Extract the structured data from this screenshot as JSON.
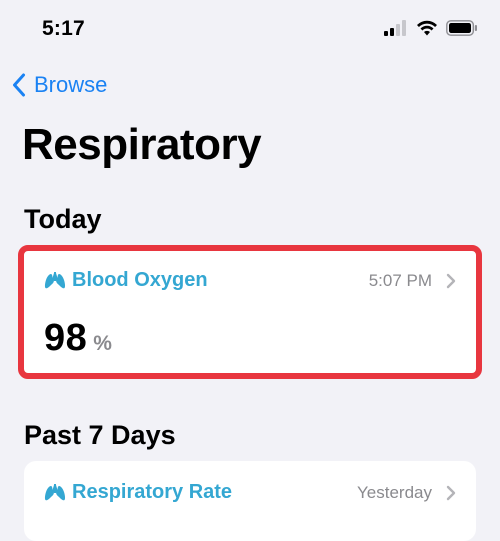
{
  "status_bar": {
    "time": "5:17",
    "icons": [
      "cellular-signal-icon",
      "wifi-icon",
      "battery-icon"
    ]
  },
  "nav": {
    "back_label": "Browse",
    "back_icon": "chevron-left-icon"
  },
  "page": {
    "title": "Respiratory"
  },
  "sections": {
    "today": {
      "title": "Today",
      "card": {
        "icon": "lungs-icon",
        "metric": "Blood Oxygen",
        "time": "5:07 PM",
        "value": "98",
        "unit": "%"
      }
    },
    "past7": {
      "title": "Past 7 Days",
      "card": {
        "icon": "lungs-icon",
        "metric": "Respiratory Rate",
        "time": "Yesterday"
      }
    }
  },
  "colors": {
    "accent": "#1a82f3",
    "metric": "#34a7d2",
    "highlight_border": "#e8363f",
    "background": "#f2f2f7"
  }
}
